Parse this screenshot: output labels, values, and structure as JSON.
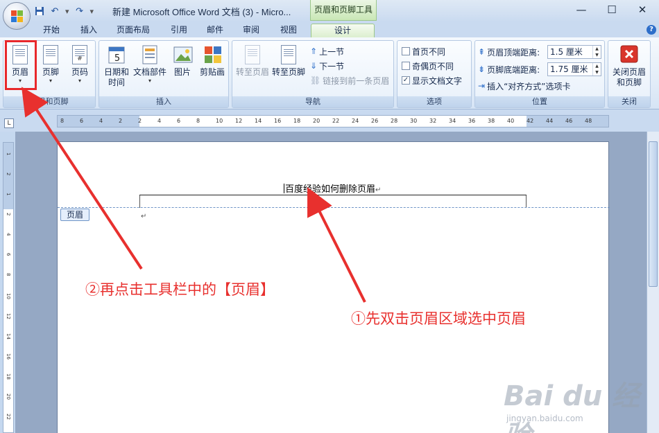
{
  "titlebar": {
    "document_title": "新建 Microsoft Office Word 文档 (3) - Micro...",
    "context_tool_title": "页眉和页脚工具",
    "minimize": "—",
    "restore": "☐",
    "close": "✕"
  },
  "tabs": [
    {
      "label": "开始"
    },
    {
      "label": "插入"
    },
    {
      "label": "页面布局"
    },
    {
      "label": "引用"
    },
    {
      "label": "邮件"
    },
    {
      "label": "审阅"
    },
    {
      "label": "视图"
    },
    {
      "label": "设计"
    }
  ],
  "help": "?",
  "groups": {
    "header_footer": {
      "label": "页眉和页脚",
      "header": "页眉",
      "footer": "页脚",
      "page_number": "页码"
    },
    "insert": {
      "label": "插入",
      "date_time_line1": "日期和",
      "date_time_line2": "时间",
      "doc_parts": "文档部件",
      "picture": "图片",
      "clipart": "剪贴画"
    },
    "navigation": {
      "label": "导航",
      "goto_header": "转至页眉",
      "goto_footer": "转至页脚",
      "prev_section": "上一节",
      "next_section": "下一节",
      "link_previous": "链接到前一条页眉"
    },
    "options": {
      "label": "选项",
      "different_first": "首页不同",
      "different_odd_even": "奇偶页不同",
      "show_doc_text": "显示文档文字",
      "show_doc_text_checked": true
    },
    "position": {
      "label": "位置",
      "header_from_top": "页眉顶端距离:",
      "header_from_top_value": "1.5 厘米",
      "footer_from_bottom": "页脚底端距离:",
      "footer_from_bottom_value": "1.75 厘米",
      "insert_align_tab": "插入“对齐方式”选项卡"
    },
    "close": {
      "label": "关闭",
      "close_line1": "关闭页眉",
      "close_line2": "和页脚"
    }
  },
  "ruler": {
    "h_ticks": [
      "8",
      "6",
      "4",
      "2",
      "2",
      "4",
      "6",
      "8",
      "10",
      "12",
      "14",
      "16",
      "18",
      "20",
      "22",
      "24",
      "26",
      "28",
      "30",
      "32",
      "34",
      "36",
      "38",
      "40",
      "42",
      "44",
      "46",
      "48"
    ],
    "v_ticks": [
      "1",
      "2",
      "1",
      "2",
      "4",
      "6",
      "8",
      "10",
      "12",
      "14",
      "16",
      "18",
      "20",
      "22"
    ]
  },
  "document": {
    "header_text": "百度经验如何删除页眉",
    "para_mark": "↵",
    "header_badge": "页眉"
  },
  "annotations": {
    "step1": "①先双击页眉区域选中页眉",
    "step2": "②再点击工具栏中的【页眉】"
  },
  "watermark": {
    "logo": "Bai du 经验",
    "url": "jingyan.baidu.com"
  },
  "colors": {
    "annotation_red": "#e8302e",
    "ribbon_blue": "#c9daf0",
    "context_green": "#c9e7b6"
  }
}
